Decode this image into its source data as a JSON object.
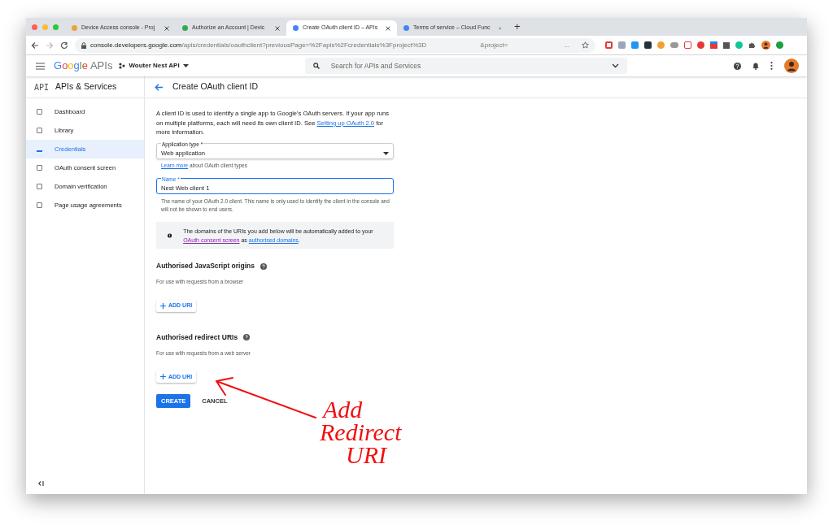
{
  "browser": {
    "tabs": [
      {
        "title": "Device Access console - Proj",
        "selected": false
      },
      {
        "title": "Authorize an Account  |  Devic",
        "selected": false
      },
      {
        "title": "Create OAuth client ID – APIs",
        "selected": true
      },
      {
        "title": "Terms of service – Cloud Func",
        "selected": false
      }
    ],
    "new_tab": "+",
    "url": {
      "host": "console.developers.google.com",
      "path": "/apis/credentials/oauthclient?previousPage=%2Fapis%2Fcredentials%3Fproject%3D",
      "param": "&project=",
      "more": "..."
    }
  },
  "header": {
    "brand": "Google",
    "brand_suffix": "APIs",
    "project": "Wouter Nest API",
    "search_placeholder": "Search for APIs and Services"
  },
  "sidebar": {
    "logo": "API",
    "title": "APIs & Services",
    "items": [
      {
        "label": "Dashboard",
        "selected": false
      },
      {
        "label": "Library",
        "selected": false
      },
      {
        "label": "Credentials",
        "selected": true
      },
      {
        "label": "OAuth consent screen",
        "selected": false
      },
      {
        "label": "Domain verification",
        "selected": false
      },
      {
        "label": "Page usage agreements",
        "selected": false
      }
    ]
  },
  "page": {
    "title": "Create OAuth client ID",
    "intro": {
      "before": "A client ID is used to identify a single app to Google's OAuth servers. If your app runs on multiple platforms, each will need its own client ID. See ",
      "link": "Setting up OAuth 2.0",
      "after": " for more information."
    },
    "app_type": {
      "label": "Application type *",
      "value": "Web application",
      "help_link": "Learn more",
      "help_text": " about OAuth client types"
    },
    "name": {
      "label": "Name *",
      "value": "Nest Web client 1",
      "focused": true,
      "help": "The name of your OAuth 2.0 client. This name is only used to identify the client in the console and will not be shown to end users."
    },
    "info": {
      "before": "The domains of the URIs you add below will be automatically added to your ",
      "link1": "OAuth consent screen",
      "middle": " as ",
      "link2": "authorised domains",
      "after": "."
    },
    "sections": [
      {
        "title": "Authorised JavaScript origins",
        "subtitle": "For use with requests from a browser",
        "button": "ADD URI"
      },
      {
        "title": "Authorised redirect URIs",
        "subtitle": "For use with requests from a web server",
        "button": "ADD URI"
      }
    ],
    "create": "CREATE",
    "cancel": "CANCEL"
  },
  "annotation": {
    "lines": [
      "Add",
      "Redirect",
      "URI"
    ]
  }
}
